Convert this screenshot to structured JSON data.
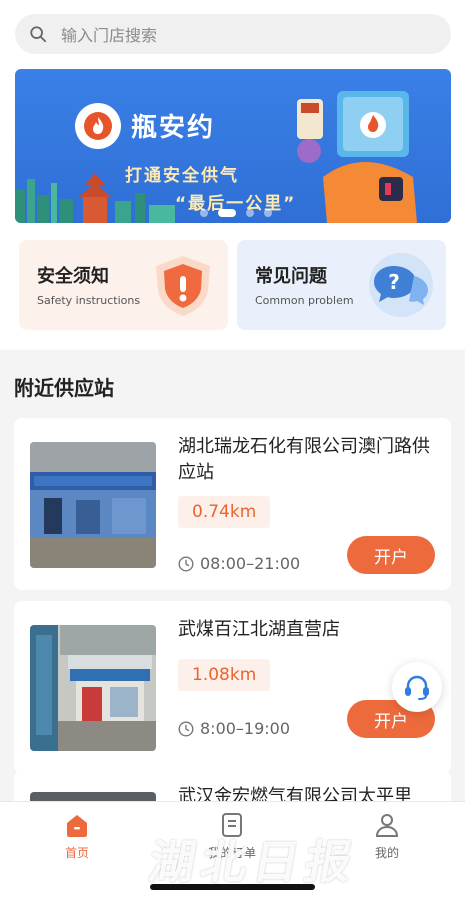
{
  "search": {
    "placeholder": "输入门店搜索"
  },
  "banner": {
    "brand": "瓶安约",
    "slogan_line1": "打通安全供气",
    "slogan_line2": "“最后一公里”",
    "primary_color": "#3a80e6"
  },
  "quick_cards": [
    {
      "title": "安全须知",
      "subtitle": "Safety instructions",
      "icon": "shield-exclamation-icon"
    },
    {
      "title": "常见问题",
      "subtitle": "Common problem",
      "icon": "question-bubble-icon"
    }
  ],
  "nearby": {
    "title": "附近供应站",
    "stores": [
      {
        "name": "湖北瑞龙石化有限公司澳门路供应站",
        "distance": "0.74km",
        "hours": "08:00–21:00",
        "action": "开户",
        "photo": "storefront-photo"
      },
      {
        "name": "武煤百江北湖直营店",
        "distance": "1.08km",
        "hours": "8:00–19:00",
        "action": "开户",
        "photo": "storefront-photo"
      },
      {
        "name": "武汉金宏燃气有限公司太平里",
        "distance": "",
        "hours": "",
        "action": "",
        "photo": "storefront-photo"
      }
    ]
  },
  "tabs": [
    {
      "label": "首页",
      "icon": "home-icon",
      "active": true
    },
    {
      "label": "我的订单",
      "icon": "order-list-icon",
      "active": false
    },
    {
      "label": "我的",
      "icon": "user-icon",
      "active": false
    }
  ],
  "watermark": "湖北日报",
  "colors": {
    "accent": "#ed6a3c",
    "accent_light": "#fdf0ea"
  }
}
